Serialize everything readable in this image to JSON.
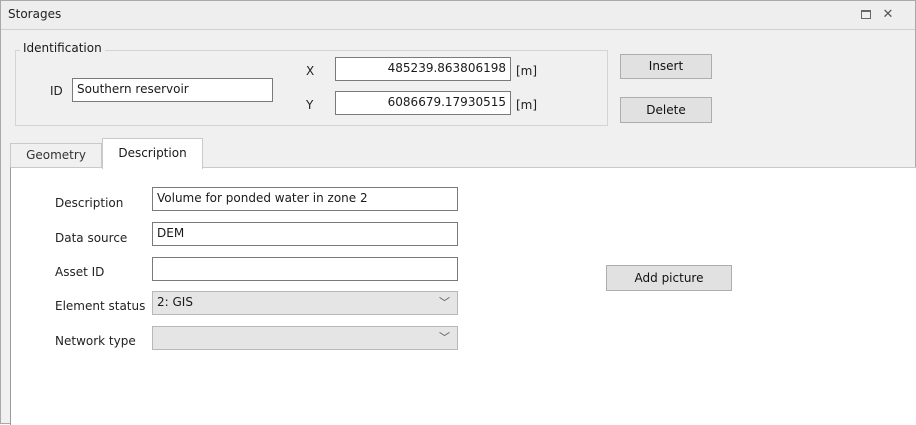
{
  "window": {
    "title": "Storages",
    "restore_icon": "restore-icon",
    "close_icon": "close-icon",
    "close_glyph": "✕"
  },
  "identification": {
    "legend": "Identification",
    "id_label": "ID",
    "id_value": "Southern reservoir",
    "x_label": "X",
    "x_value": "485239.863806198",
    "x_unit": "[m]",
    "y_label": "Y",
    "y_value": "6086679.17930515",
    "y_unit": "[m]"
  },
  "buttons": {
    "insert": "Insert",
    "delete": "Delete",
    "add_picture": "Add picture"
  },
  "tabs": [
    {
      "label": "Geometry",
      "active": false
    },
    {
      "label": "Description",
      "active": true
    }
  ],
  "description_form": {
    "description_label": "Description",
    "description_value": "Volume for ponded water in zone 2",
    "data_source_label": "Data source",
    "data_source_value": "DEM",
    "asset_id_label": "Asset ID",
    "asset_id_value": "",
    "element_status_label": "Element status",
    "element_status_value": "2: GIS",
    "network_type_label": "Network type",
    "network_type_value": ""
  },
  "icons": {
    "dropdown": "chevron-down-icon",
    "dropdown_glyph": "﹀"
  }
}
